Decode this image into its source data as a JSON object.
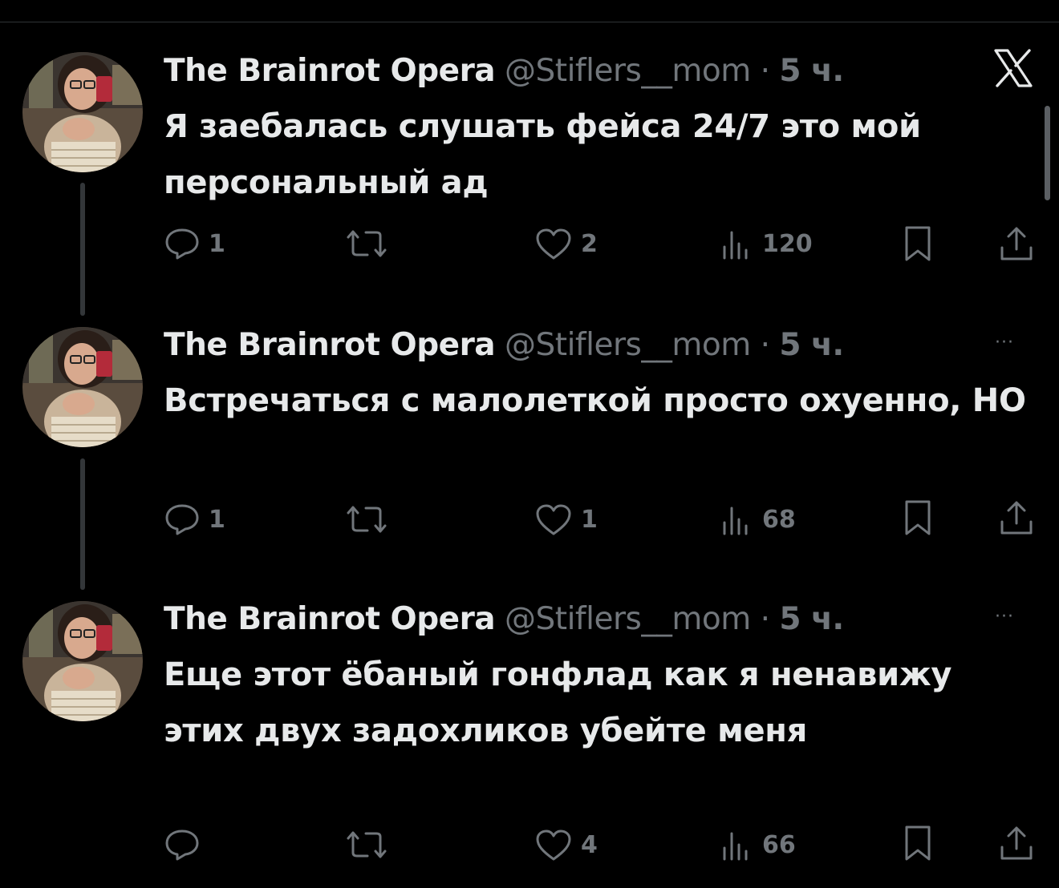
{
  "icons": {
    "platform": "x-logo",
    "more": "more-icon",
    "reply": "reply-icon",
    "repost": "repost-icon",
    "like": "heart-icon",
    "views": "views-icon",
    "bookmark": "bookmark-icon",
    "share": "share-icon"
  },
  "colors": {
    "background": "#000000",
    "text": "#e7e9ea",
    "muted": "#71767b"
  },
  "more_label": "···",
  "tweets": [
    {
      "author_name": "The Brainrot Opera",
      "handle": "@Stiflers__mom",
      "dot": "·",
      "time": "5 ч.",
      "text": "Я заебалась слушать фейса 24/7 это мой персональный ад",
      "replies": "1",
      "reposts": "",
      "likes": "2",
      "views": "120"
    },
    {
      "author_name": "The Brainrot Opera",
      "handle": "@Stiflers__mom",
      "dot": "·",
      "time": "5 ч.",
      "text": "Встречаться с малолеткой просто охуенно, НО",
      "replies": "1",
      "reposts": "",
      "likes": "1",
      "views": "68"
    },
    {
      "author_name": "The Brainrot Opera",
      "handle": "@Stiflers__mom",
      "dot": "·",
      "time": "5 ч.",
      "text": "Еще этот ёбаный гонфлад как я ненавижу этих двух задохликов убейте меня",
      "replies": "",
      "reposts": "",
      "likes": "4",
      "views": "66"
    }
  ]
}
